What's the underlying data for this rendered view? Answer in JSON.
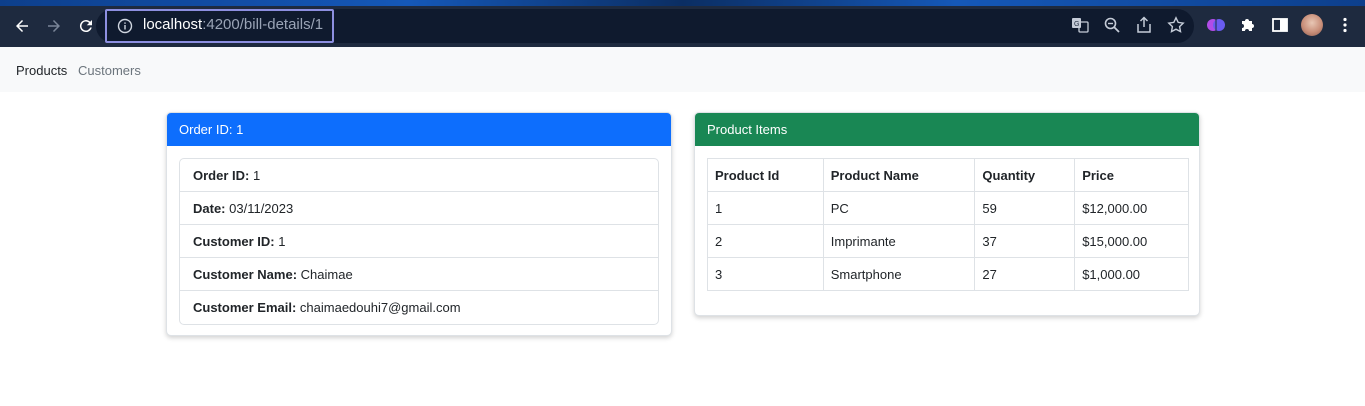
{
  "browser": {
    "url_host": "localhost",
    "url_path": ":4200/bill-details/1",
    "icons": [
      "back-arrow-icon",
      "forward-arrow-icon",
      "reload-icon",
      "info-icon",
      "translate-icon",
      "zoom-icon",
      "share-icon",
      "star-icon",
      "brain-extension-icon",
      "puzzle-icon",
      "sidepanel-icon",
      "menu-dots-icon"
    ]
  },
  "navbar": {
    "items": [
      {
        "label": "Products"
      },
      {
        "label": "Customers"
      }
    ]
  },
  "order_card": {
    "header": "Order ID: 1",
    "fields": [
      {
        "label": "Order ID:",
        "value": " 1"
      },
      {
        "label": "Date:",
        "value": " 03/11/2023"
      },
      {
        "label": "Customer ID:",
        "value": " 1"
      },
      {
        "label": "Customer Name:",
        "value": " Chaimae"
      },
      {
        "label": "Customer Email:",
        "value": " chaimaedouhi7@gmail.com"
      }
    ],
    "color": "#0d6efd"
  },
  "items_card": {
    "header": "Product Items",
    "color": "#198754",
    "columns": [
      "Product Id",
      "Product Name",
      "Quantity",
      "Price"
    ],
    "rows": [
      [
        "1",
        "PC",
        "59",
        "$12,000.00"
      ],
      [
        "2",
        "Imprimante",
        "37",
        "$15,000.00"
      ],
      [
        "3",
        "Smartphone",
        "27",
        "$1,000.00"
      ]
    ]
  }
}
